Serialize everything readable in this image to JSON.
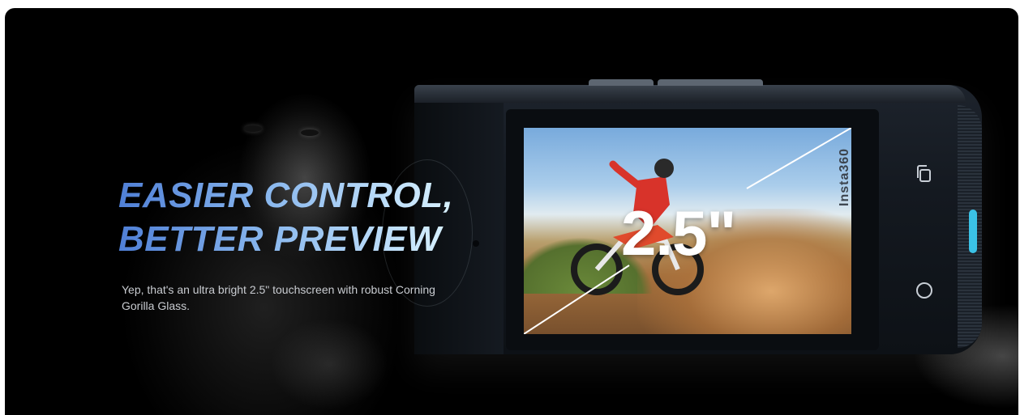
{
  "hero": {
    "headline_line1": "EASIER CONTROL,",
    "headline_line2": "BETTER PREVIEW",
    "description": "Yep, that's an ultra bright 2.5\" touchscreen with robust Corning Gorilla Glass.",
    "headline_gradient": [
      "#4f7fd6",
      "#8ab8ee",
      "#d9f2ff"
    ]
  },
  "device": {
    "screen_size_label": "2.5\"",
    "brand_label": "Insta360",
    "accent_color": "#3bc2e6",
    "side_buttons": [
      "copy-icon",
      "circle-button-icon"
    ]
  },
  "colors": {
    "background": "#000000",
    "subcopy": "#c9ccd1"
  }
}
